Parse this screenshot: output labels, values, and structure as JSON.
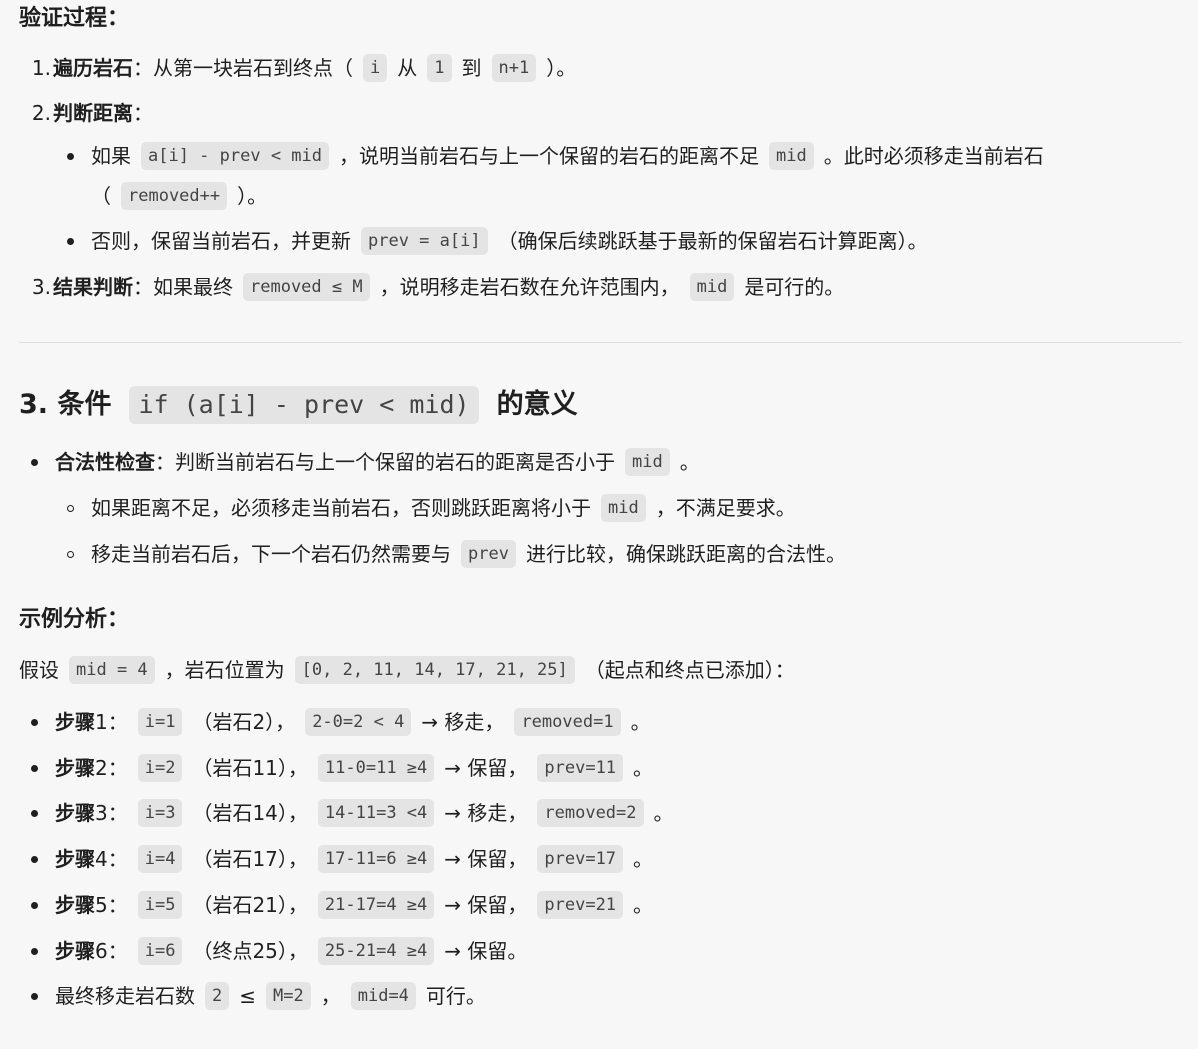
{
  "verify": {
    "title": "验证过程：",
    "item1": {
      "num": "1.",
      "bold": "遍历岩石",
      "text": "：从第一块岩石到终点（",
      "code1": "i",
      "t2": "从",
      "code2": "1",
      "t3": "到",
      "code3": "n+1",
      "t4": "）。"
    },
    "item2": {
      "num": "2.",
      "bold": "判断距离",
      "text": "："
    },
    "sub1": {
      "t1": "如果",
      "code1": "a[i] - prev < mid",
      "t2": "，说明当前岩石与上一个保留的岩石的距离不足",
      "code2": "mid",
      "t3": "。此时必须移走当前岩石"
    },
    "sub1b": {
      "t1": "（",
      "code1": "removed++",
      "t2": "）。"
    },
    "sub2": {
      "t1": "否则，保留当前岩石，并更新",
      "code1": "prev = a[i]",
      "t2": "（确保后续跳跃基于最新的保留岩石计算距离）。"
    },
    "item3": {
      "num": "3.",
      "bold": "结果判断",
      "text": "：如果最终",
      "code1": "removed ≤ M",
      "t2": "，说明移走岩石数在允许范围内，",
      "code2": "mid",
      "t3": "是可行的。"
    }
  },
  "section3": {
    "prefix": "3. 条件",
    "code": "if (a[i] - prev < mid)",
    "suffix": "的意义",
    "b1": {
      "bold": "合法性检查",
      "text": "：判断当前岩石与上一个保留的岩石的距离是否小于",
      "code1": "mid",
      "t2": "。"
    },
    "c1": {
      "t1": "如果距离不足，必须移走当前岩石，否则跳跃距离将小于",
      "code1": "mid",
      "t2": "，不满足要求。"
    },
    "c2": {
      "t1": "移走当前岩石后，下一个岩石仍然需要与",
      "code1": "prev",
      "t2": "进行比较，确保跳跃距离的合法性。"
    }
  },
  "example": {
    "title": "示例分析：",
    "intro": {
      "t1": "假设",
      "code1": "mid = 4",
      "t2": "，岩石位置为",
      "code2": "[0, 2, 11, 14, 17, 21, 25]",
      "t3": "（起点和终点已添加）："
    },
    "steps": [
      {
        "bold": "步骤",
        "n": " 1：",
        "code1": "i=1",
        "t1": "（岩石2），",
        "code2": "2-0=2 < 4",
        "t2": "→ 移走，",
        "code3": "removed=1",
        "t3": "。"
      },
      {
        "bold": "步骤",
        "n": " 2：",
        "code1": "i=2",
        "t1": "（岩石11），",
        "code2": "11-0=11 ≥4",
        "t2": "→ 保留，",
        "code3": "prev=11",
        "t3": "。"
      },
      {
        "bold": "步骤",
        "n": " 3：",
        "code1": "i=3",
        "t1": "（岩石14），",
        "code2": "14-11=3 <4",
        "t2": "→ 移走，",
        "code3": "removed=2",
        "t3": "。"
      },
      {
        "bold": "步骤",
        "n": " 4：",
        "code1": "i=4",
        "t1": "（岩石17），",
        "code2": "17-11=6 ≥4",
        "t2": "→ 保留，",
        "code3": "prev=17",
        "t3": "。"
      },
      {
        "bold": "步骤",
        "n": " 5：",
        "code1": "i=5",
        "t1": "（岩石21），",
        "code2": "21-17=4 ≥4",
        "t2": "→ 保留，",
        "code3": "prev=21",
        "t3": "。"
      },
      {
        "bold": "步骤",
        "n": " 6：",
        "code1": "i=6",
        "t1": "（终点25），",
        "code2": "25-21=4 ≥4",
        "t2": "→ 保留。"
      }
    ],
    "final": {
      "t1": "最终移走岩石数",
      "code1": "2",
      "t2": "≤",
      "code2": "M=2",
      "t3": "，",
      "code3": "mid=4",
      "t4": "可行。"
    }
  }
}
